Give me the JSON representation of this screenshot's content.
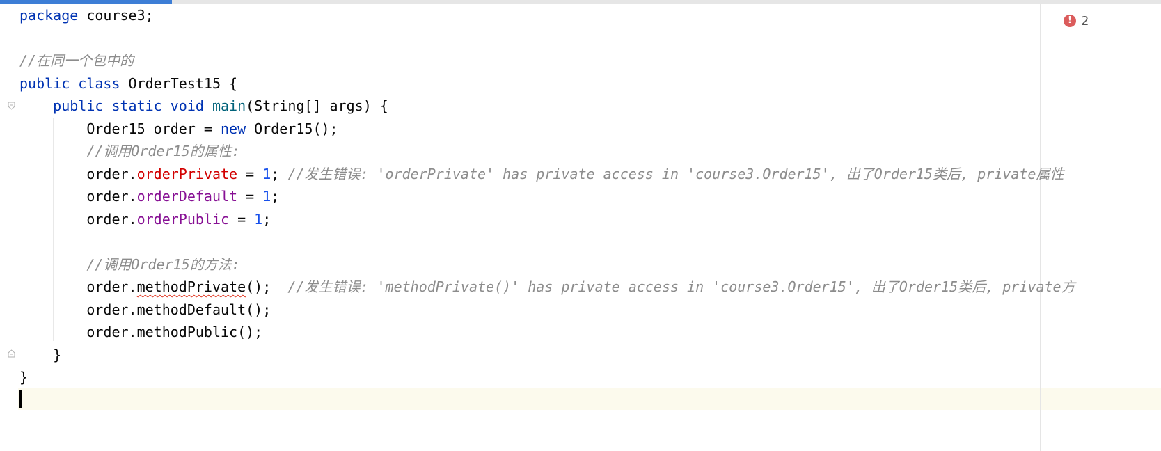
{
  "editor": {
    "scroll_progress": 0.148,
    "error_count": "2",
    "error_icon": "error-circle-icon",
    "colors": {
      "keyword": "#0033b3",
      "field": "#871094",
      "error_field": "#d20000",
      "number": "#1750eb",
      "comment": "#8c8c8c",
      "caret_line": "#fcfaed",
      "progress": "#3d7ed6",
      "error_badge": "#db5c5c"
    }
  },
  "code": {
    "l1_kw": "package",
    "l1_rest": " course3;",
    "l3_comment": "//在同一个包中的",
    "l4_kw": "public class",
    "l4_rest": " OrderTest15 {",
    "l5_indent": "    ",
    "l5_kw": "public static void",
    "l5_sp": " ",
    "l5_method": "main",
    "l5_rest": "(String[] args) {",
    "l6_a": "        Order15 order = ",
    "l6_kw": "new",
    "l6_b": " Order15();",
    "l7_comment": "        //调用Order15的属性:",
    "l8_a": "        order.",
    "l8_field": "orderPrivate",
    "l8_b": " = ",
    "l8_num": "1",
    "l8_c": "; ",
    "l8_comment": "//发生错误: 'orderPrivate' has private access in 'course3.Order15', 出了Order15类后, private属性",
    "l9_a": "        order.",
    "l9_field": "orderDefault",
    "l9_b": " = ",
    "l9_num": "1",
    "l9_c": ";",
    "l10_a": "        order.",
    "l10_field": "orderPublic",
    "l10_b": " = ",
    "l10_num": "1",
    "l10_c": ";",
    "l12_comment": "        //调用Order15的方法:",
    "l13_a": "        order.",
    "l13_method": "methodPrivate",
    "l13_b": "();  ",
    "l13_comment": "//发生错误: 'methodPrivate()' has private access in 'course3.Order15', 出了Order15类后, private方",
    "l14": "        order.methodDefault();",
    "l15": "        order.methodPublic();",
    "l16": "    }",
    "l17": "}"
  }
}
